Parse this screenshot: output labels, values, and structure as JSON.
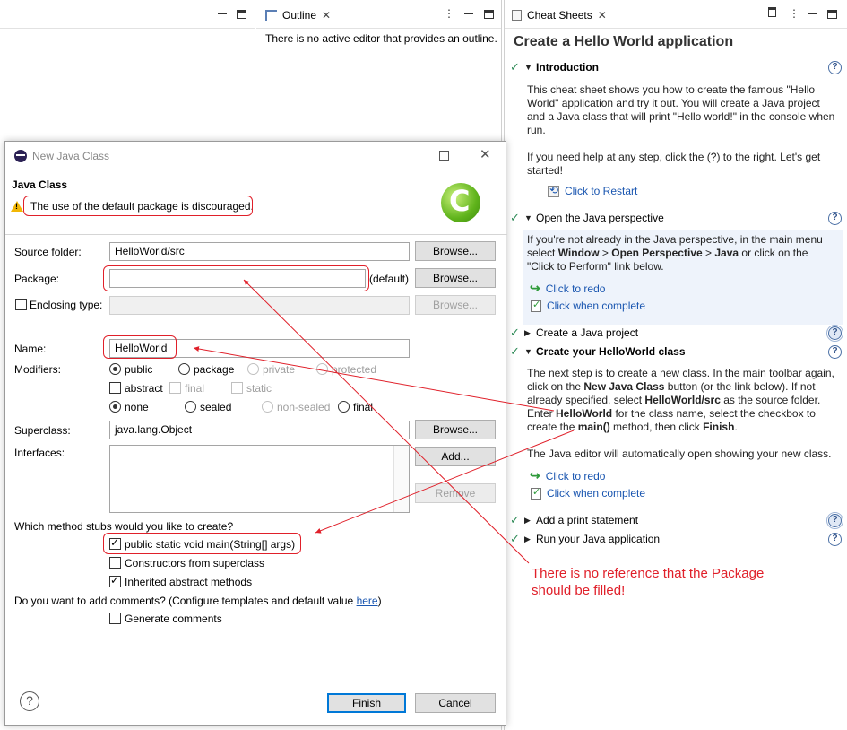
{
  "outline": {
    "tab_label": "Outline",
    "message": "There is no active editor that provides an outline."
  },
  "cheat": {
    "tab_label": "Cheat Sheets",
    "title": "Create a Hello World application",
    "intro_title": "Introduction",
    "intro_p1": "This cheat sheet shows you how to create the famous \"Hello World\" application and try it out. You will create a Java project and a Java class that will print \"Hello world!\" in the console when run.",
    "intro_p2": "If you need help at any step, click the (?) to the right. Let's get started!",
    "restart": "Click to Restart",
    "persp_title": "Open the Java perspective",
    "persp_p1": "If you're not already in the Java perspective, in the main menu select",
    "persp_window": "Window",
    "persp_gt1": " > ",
    "persp_open": "Open Perspective",
    "persp_gt2": " > ",
    "persp_java": "Java",
    "persp_p2": " or click on the \"Click to Perform\" link below.",
    "redo": "Click to redo",
    "complete": "Click when complete",
    "project_title": "Create a Java project",
    "class_title": "Create your HelloWorld class",
    "class_p1_a": "The next step is to create a new class. In the main toolbar again, click on the ",
    "class_p1_b": "New Java Class",
    "class_p1_c": " button (or the link below). If not already specified, select ",
    "class_p1_d": "HelloWorld/src",
    "class_p1_e": " as the source folder. Enter ",
    "class_p1_f": "HelloWorld",
    "class_p1_g": " for the class name, select the checkbox to create the ",
    "class_p1_h": "main()",
    "class_p1_i": " method, then click ",
    "class_p1_j": "Finish",
    "class_p1_k": ".",
    "class_p2": "The Java editor will automatically open showing your new class.",
    "print_title": "Add a print statement",
    "run_title": "Run your Java application"
  },
  "dialog": {
    "title": "New Java Class",
    "heading": "Java Class",
    "warning": "The use of the default package is discouraged.",
    "source_folder_label": "Source folder:",
    "source_folder_value": "HelloWorld/src",
    "browse": "Browse...",
    "package_label": "Package:",
    "package_value": "",
    "package_default": "(default)",
    "enclosing_label": "Enclosing type:",
    "name_label": "Name:",
    "name_value": "HelloWorld",
    "modifiers_label": "Modifiers:",
    "mod_public": "public",
    "mod_package": "package",
    "mod_private": "private",
    "mod_protected": "protected",
    "mod_abstract": "abstract",
    "mod_final": "final",
    "mod_static": "static",
    "mod_none": "none",
    "mod_sealed": "sealed",
    "mod_nonsealed": "non-sealed",
    "mod_final2": "final",
    "superclass_label": "Superclass:",
    "superclass_value": "java.lang.Object",
    "interfaces_label": "Interfaces:",
    "add": "Add...",
    "remove": "Remove",
    "stubs_question": "Which method stubs would you like to create?",
    "stub_main": "public static void main(String[] args)",
    "stub_ctor": "Constructors from superclass",
    "stub_inherited": "Inherited abstract methods",
    "comments_question": "Do you want to add comments? (Configure templates and default value ",
    "comments_link": "here",
    "comments_close": ")",
    "generate_comments": "Generate comments",
    "finish": "Finish",
    "cancel": "Cancel"
  },
  "annotation": {
    "line1": "There is no reference that the Package",
    "line2": "should be filled!"
  },
  "colors": {
    "annotation_red": "#e0202a",
    "link_blue": "#1a56b0",
    "check_green": "#2e8b57"
  }
}
